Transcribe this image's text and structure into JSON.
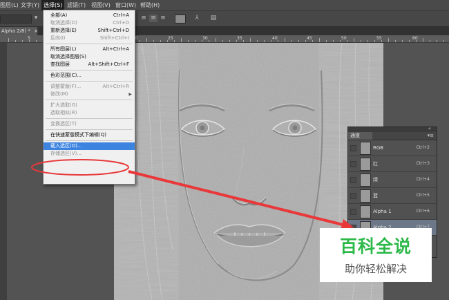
{
  "menubar": {
    "items": [
      {
        "label": "图层(L)",
        "active": false
      },
      {
        "label": "文字(Y)",
        "active": false
      },
      {
        "label": "选择(S)",
        "active": true
      },
      {
        "label": "滤镜(T)",
        "active": false
      },
      {
        "label": "视图(V)",
        "active": false
      },
      {
        "label": "窗口(W)",
        "active": false
      },
      {
        "label": "帮助(H)",
        "active": false
      }
    ]
  },
  "document_tab": {
    "label": "Alpha 2/8) *",
    "close": "×"
  },
  "ruler": {
    "numbers": [
      "5",
      "10",
      "15",
      "20",
      "25",
      "30",
      "35",
      "40",
      "45",
      "50",
      "55",
      "60"
    ]
  },
  "select_menu": {
    "items": [
      {
        "label": "全部(A)",
        "shortcut": "Ctrl+A",
        "disabled": false,
        "highlight": false
      },
      {
        "label": "取消选择(D)",
        "shortcut": "Ctrl+D",
        "disabled": true,
        "highlight": false
      },
      {
        "label": "重新选择(E)",
        "shortcut": "Shift+Ctrl+D",
        "disabled": false,
        "highlight": false
      },
      {
        "label": "反向(I)",
        "shortcut": "Shift+Ctrl+I",
        "disabled": true,
        "highlight": false
      },
      {
        "sep": true
      },
      {
        "label": "所有图层(L)",
        "shortcut": "Alt+Ctrl+A",
        "disabled": false,
        "highlight": false
      },
      {
        "label": "取消选择图层(S)",
        "shortcut": "",
        "disabled": false,
        "highlight": false
      },
      {
        "label": "查找图层",
        "shortcut": "Alt+Shift+Ctrl+F",
        "disabled": false,
        "highlight": false
      },
      {
        "sep": true
      },
      {
        "label": "色彩范围(C)...",
        "shortcut": "",
        "disabled": false,
        "highlight": false
      },
      {
        "sep": true
      },
      {
        "label": "调整蒙版(F)...",
        "shortcut": "Alt+Ctrl+R",
        "disabled": true,
        "highlight": false
      },
      {
        "label": "修改(M)",
        "shortcut": "",
        "disabled": true,
        "highlight": false,
        "submenu": true
      },
      {
        "sep": true
      },
      {
        "label": "扩大选取(G)",
        "shortcut": "",
        "disabled": true,
        "highlight": false
      },
      {
        "label": "选取相似(R)",
        "shortcut": "",
        "disabled": true,
        "highlight": false
      },
      {
        "sep": true
      },
      {
        "label": "变换选区(T)",
        "shortcut": "",
        "disabled": true,
        "highlight": false
      },
      {
        "sep": true
      },
      {
        "label": "在快速蒙版模式下编辑(Q)",
        "shortcut": "",
        "disabled": false,
        "highlight": false
      },
      {
        "sep": true
      },
      {
        "label": "载入选区(O)...",
        "shortcut": "",
        "disabled": false,
        "highlight": true
      },
      {
        "label": "存储选区(V)...",
        "shortcut": "",
        "disabled": true,
        "highlight": false
      }
    ]
  },
  "channels_panel": {
    "title": "通道",
    "channels": [
      {
        "name": "RGB",
        "shortcut": "Ctrl+2",
        "selected": false
      },
      {
        "name": "红",
        "shortcut": "Ctrl+3",
        "selected": false
      },
      {
        "name": "绿",
        "shortcut": "Ctrl+4",
        "selected": false
      },
      {
        "name": "蓝",
        "shortcut": "Ctrl+5",
        "selected": false
      },
      {
        "name": "Alpha 1",
        "shortcut": "Ctrl+6",
        "selected": false
      },
      {
        "name": "Alpha 2",
        "shortcut": "Ctrl+7",
        "selected": true
      }
    ]
  },
  "watermark": {
    "title": "百科全说",
    "subtitle": "助你轻松解决"
  },
  "colors": {
    "accent_highlight": "#3d84e0",
    "callout_red": "#e8383a",
    "watermark_green": "#2db94a"
  }
}
